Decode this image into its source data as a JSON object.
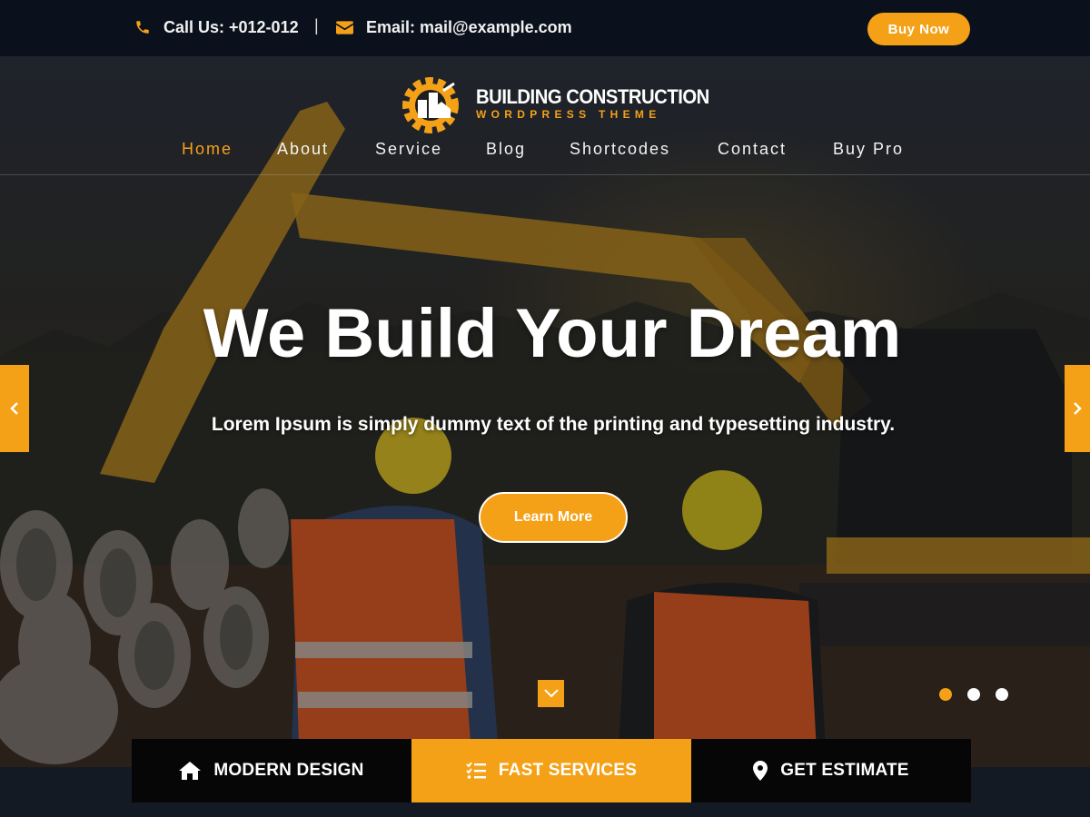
{
  "topbar": {
    "phone_text": "Call Us: +012-012",
    "separator": "|",
    "email_text": "Email: mail@example.com",
    "buy_now_label": "Buy Now"
  },
  "logo": {
    "title": "BUILDING CONSTRUCTION",
    "subtitle": "WORDPRESS THEME"
  },
  "nav": {
    "items": [
      {
        "label": "Home",
        "active": true
      },
      {
        "label": "About"
      },
      {
        "label": "Service"
      },
      {
        "label": "Blog"
      },
      {
        "label": "Shortcodes"
      },
      {
        "label": "Contact"
      },
      {
        "label": "Buy Pro"
      }
    ]
  },
  "hero": {
    "headline": "We Build Your Dream",
    "subline": "Lorem Ipsum is simply dummy text of the printing and typesetting industry.",
    "cta_label": "Learn More",
    "slide_count": 3,
    "active_slide": 1
  },
  "features": [
    {
      "label": "MODERN DESIGN",
      "icon": "home-icon"
    },
    {
      "label": "FAST SERVICES",
      "icon": "checklist-icon"
    },
    {
      "label": "GET ESTIMATE",
      "icon": "map-pin-icon"
    }
  ],
  "colors": {
    "accent": "#f5a117",
    "topbar_bg": "#0b111c",
    "feature_dark": "#060606"
  }
}
